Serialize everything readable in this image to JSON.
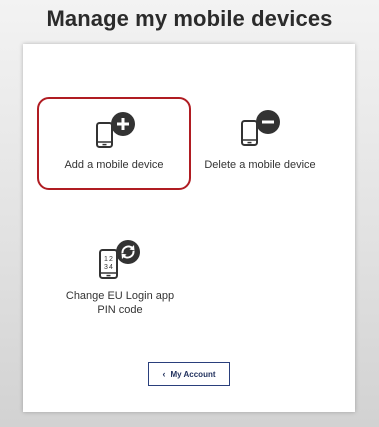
{
  "page": {
    "title": "Manage my mobile devices"
  },
  "options": {
    "add": {
      "label": "Add a mobile device",
      "icon": "phone-add-icon",
      "highlighted": true
    },
    "delete": {
      "label": "Delete a mobile device",
      "icon": "phone-remove-icon"
    },
    "pin": {
      "label_line1": "Change EU Login app",
      "label_line2": "PIN code",
      "icon": "phone-pin-refresh-icon"
    }
  },
  "footer": {
    "account_button_label": "My Account",
    "account_button_icon": "chevron-left-icon"
  },
  "colors": {
    "highlight_border": "#b01c22",
    "icon_dark": "#333333",
    "button_border": "#2a3f7c"
  }
}
